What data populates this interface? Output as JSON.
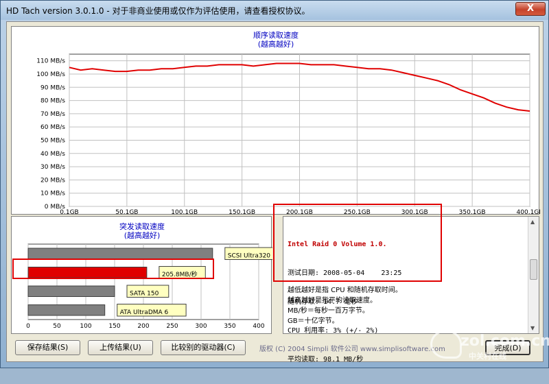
{
  "window": {
    "title": "HD Tach version 3.0.1.0 - 对于非商业使用或仅作为评估使用，请查看授权协议。",
    "close_glyph": "X"
  },
  "colors": {
    "accent": "#0000c0",
    "series": "#e00000",
    "highlight": "#e00000"
  },
  "chart_data": [
    {
      "type": "line",
      "title": "顺序读取速度",
      "subtitle": "(越高越好)",
      "yticks": [
        "0 MB/s",
        "10 MB/s",
        "20 MB/s",
        "30 MB/s",
        "40 MB/s",
        "50 MB/s",
        "60 MB/s",
        "70 MB/s",
        "80 MB/s",
        "90 MB/s",
        "100 MB/s",
        "110 MB/s"
      ],
      "xticks": [
        "0.1GB",
        "50.1GB",
        "100.1GB",
        "150.1GB",
        "200.1GB",
        "250.1GB",
        "300.1GB",
        "350.1GB",
        "400.1GB"
      ],
      "ylim": [
        0,
        115
      ],
      "xlim": [
        0.1,
        400.1
      ],
      "grid": true,
      "series": [
        {
          "x": [
            0.1,
            10,
            20,
            30,
            40,
            50,
            60,
            70,
            80,
            90,
            100,
            110,
            120,
            130,
            140,
            150,
            160,
            170,
            180,
            190,
            200,
            210,
            220,
            230,
            240,
            250,
            260,
            270,
            280,
            290,
            300,
            310,
            320,
            330,
            340,
            350,
            360,
            370,
            380,
            390,
            400.1
          ],
          "y": [
            105,
            103,
            104,
            103,
            102,
            102,
            103,
            103,
            104,
            104,
            105,
            106,
            106,
            107,
            107,
            107,
            106,
            107,
            108,
            108,
            108,
            107,
            107,
            107,
            106,
            105,
            104,
            104,
            103,
            101,
            99,
            97,
            95,
            92,
            88,
            85,
            82,
            78,
            75,
            73,
            72
          ]
        }
      ]
    },
    {
      "type": "bar",
      "title": "突发读取速度",
      "subtitle": "(越高越好)",
      "categories": [
        "SCSI Ultra320",
        "205.8MB/秒",
        "SATA 150",
        "ATA UltraDMA 6"
      ],
      "values": [
        320,
        205.8,
        150,
        133
      ],
      "xticks": [
        "0",
        "50",
        "100",
        "150",
        "200",
        "250",
        "300",
        "350",
        "400"
      ],
      "xlim": [
        0,
        400
      ],
      "grid": true,
      "bar_colors": [
        "#808080",
        "#e00000",
        "#808080",
        "#808080"
      ]
    }
  ],
  "info": {
    "heading": "Intel Raid 0 Volume 1.0.",
    "lines": [
      "测试日期: 2008-05-04    23:25",
      "随机存取: 14.7 毫秒",
      "CPU 利用率: 3% (+/- 2%)",
      "平均读取: 98.1 MB/秒"
    ],
    "notes": [
      "越低越好是指 CPU 和随机存取时间。",
      "越高越好是指平均读取速度。",
      "MB/秒＝每秒一百万字节。",
      "GB＝十亿字节。"
    ]
  },
  "buttons": {
    "save": "保存结果(S)",
    "upload": "上传结果(U)",
    "compare": "比较别的驱动器(C)",
    "done": "完成(D)"
  },
  "copyright": "版权 (C) 2004 Simpli 软件公司 www.simplisoftware.com",
  "watermark": {
    "brand": "zol.com.cn",
    "sub": "中关村在线"
  }
}
